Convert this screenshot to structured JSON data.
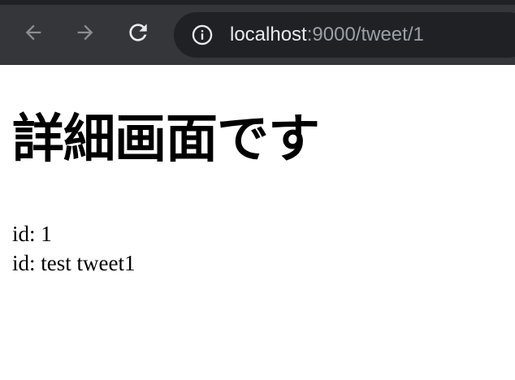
{
  "browser": {
    "url_host": "localhost",
    "url_path": ":9000/tweet/1",
    "icons": {
      "back": "arrow-left-icon",
      "forward": "arrow-right-icon",
      "reload": "reload-icon",
      "info": "info-icon"
    },
    "colors": {
      "toolbar": "#35363a",
      "omnibox": "#202124",
      "host_text": "#e8eaed",
      "path_text": "#9aa0a6"
    }
  },
  "page": {
    "title": "詳細画面です",
    "lines": [
      "id: 1",
      "id: test tweet1"
    ]
  }
}
